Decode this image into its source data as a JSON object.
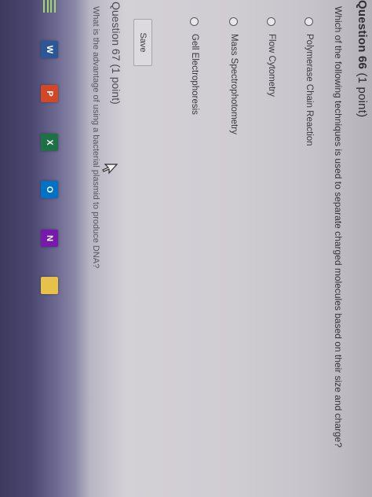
{
  "question66": {
    "title": "Question 66",
    "points": "(1 point)",
    "text": "Which of the following techniques is used to separate charged molecules based on their size and charge?",
    "options": [
      "Polymerase Chain Reaction",
      "Flow Cytometry",
      "Mass Spectrophotometry",
      "Gell Electrophoresis"
    ],
    "save_label": "Save"
  },
  "question67": {
    "title": "Question 67",
    "points": "(1 point)",
    "text": "What is the advantage of using a bacterial plasmid to produce DNA?"
  },
  "taskbar": {
    "icons": [
      {
        "name": "word-icon",
        "letter": "W",
        "color": "#2b5797"
      },
      {
        "name": "powerpoint-icon",
        "letter": "P",
        "color": "#d24726"
      },
      {
        "name": "excel-icon",
        "letter": "X",
        "color": "#1e7145"
      },
      {
        "name": "outlook-icon",
        "letter": "O",
        "color": "#0072c6"
      },
      {
        "name": "onenote-icon",
        "letter": "N",
        "color": "#7719aa"
      },
      {
        "name": "file-explorer-icon",
        "letter": "",
        "color": "#e8c14a"
      }
    ]
  }
}
